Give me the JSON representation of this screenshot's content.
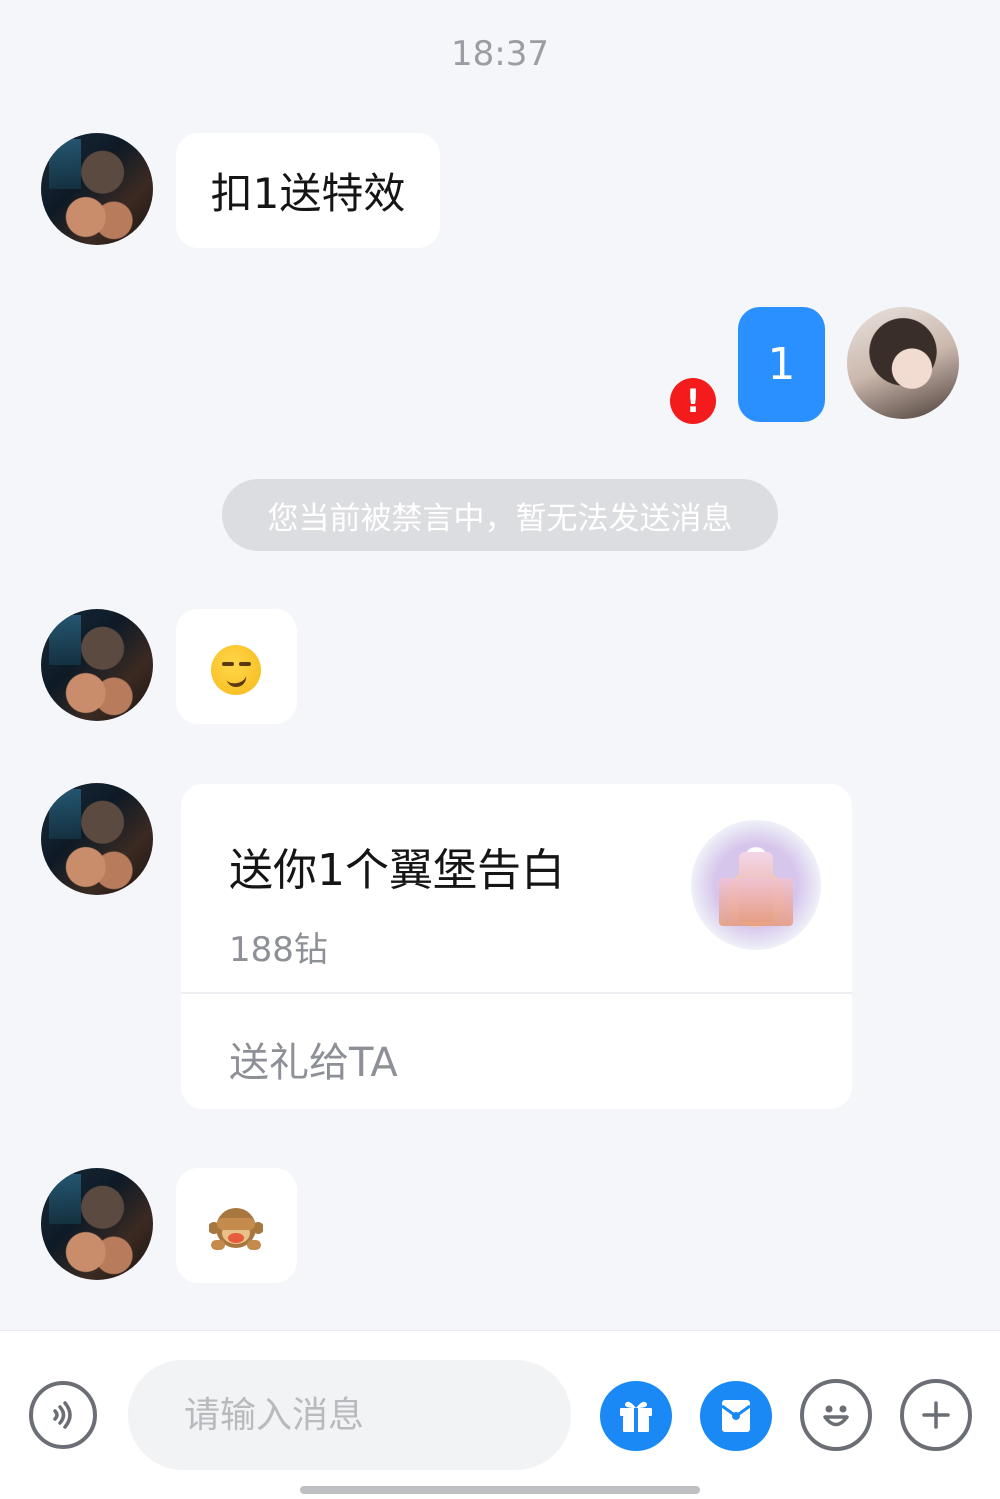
{
  "timestamp": "18:37",
  "messages": [
    {
      "from": "other",
      "type": "text",
      "text": "扣1送特效"
    },
    {
      "from": "self",
      "type": "text",
      "text": "1",
      "status": "failed",
      "status_mark": "!"
    },
    {
      "from": "system",
      "type": "notice",
      "text": "您当前被禁言中，暂无法发送消息"
    },
    {
      "from": "other",
      "type": "emoji",
      "emoji": "smirking-face"
    },
    {
      "from": "other",
      "type": "gift",
      "title": "送你1个翼堡告白",
      "price": "188钻",
      "action": "送礼给TA"
    },
    {
      "from": "other",
      "type": "emoji",
      "emoji": "see-no-evil-monkey"
    }
  ],
  "input": {
    "placeholder": "请输入消息"
  },
  "toolbar": {
    "voice_icon": "voice-icon",
    "gift_icon": "gift-icon",
    "red_packet_icon": "red-packet-icon",
    "emoji_icon": "emoji-icon",
    "plus_icon": "plus-icon"
  },
  "colors": {
    "accent": "#2b90ff",
    "error": "#f31b1b",
    "background": "#f4f6f9"
  }
}
